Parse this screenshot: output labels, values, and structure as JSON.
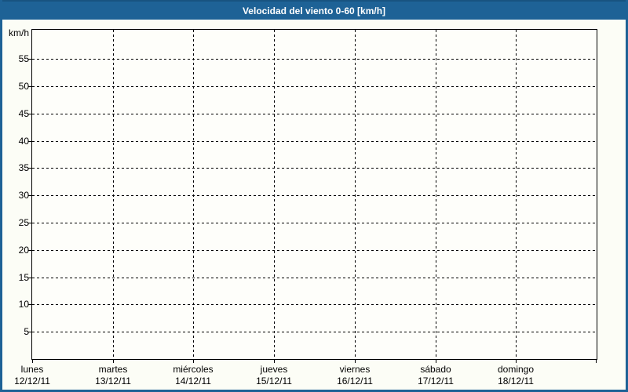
{
  "titlebar": {
    "title": "Velocidad del viento 0-60 [km/h]"
  },
  "chart_data": {
    "type": "line",
    "title": "Velocidad del viento 0-60 [km/h]",
    "ylabel": "km/h",
    "xlabel": "",
    "ylim": [
      0,
      60.35
    ],
    "ytick_interval": 5,
    "yticks": [
      5,
      10,
      15,
      20,
      25,
      30,
      35,
      40,
      45,
      50,
      55
    ],
    "categories": [
      {
        "day": "lunes",
        "date": "12/12/11"
      },
      {
        "day": "martes",
        "date": "13/12/11"
      },
      {
        "day": "miércoles",
        "date": "14/12/11"
      },
      {
        "day": "jueves",
        "date": "15/12/11"
      },
      {
        "day": "viernes",
        "date": "16/12/11"
      },
      {
        "day": "sábado",
        "date": "17/12/11"
      },
      {
        "day": "domingo",
        "date": "18/12/11"
      }
    ],
    "series": [],
    "grid": "dashed",
    "legend": "none"
  },
  "colors": {
    "accent_blue": "#1E6296",
    "titlebar_top_edge": "#185380",
    "page_background": "#FCFDF6",
    "plot_background": "#FEFEFA",
    "grid_color": "#000000",
    "title_text": "#FFFFFF",
    "label_text": "#000000"
  }
}
